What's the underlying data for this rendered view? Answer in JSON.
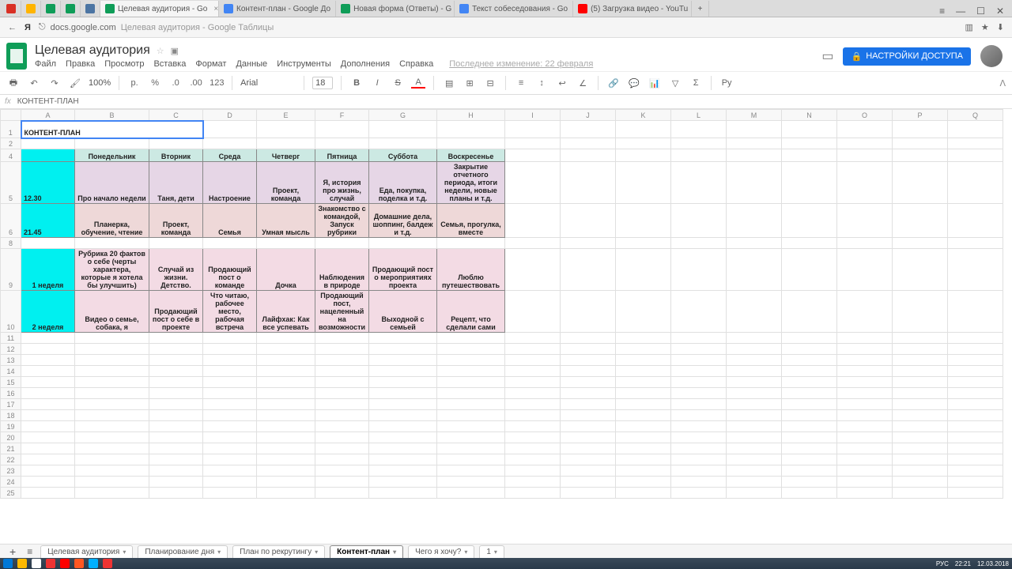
{
  "browser": {
    "tabs": [
      {
        "label": "",
        "favicon": "#d93025"
      },
      {
        "label": "",
        "favicon": "#ffb400"
      },
      {
        "label": "",
        "favicon": "#0f9d58"
      },
      {
        "label": "",
        "favicon": "#0f9d58"
      },
      {
        "label": "",
        "favicon": "#4c75a3"
      },
      {
        "label": "Целевая аудитория - Go",
        "favicon": "#0f9d58",
        "active": true,
        "close": "×"
      },
      {
        "label": "Контент-план - Google До",
        "favicon": "#4285f4"
      },
      {
        "label": "Новая форма (Ответы) - G",
        "favicon": "#0f9d58"
      },
      {
        "label": "Текст собеседования - Go",
        "favicon": "#4285f4"
      },
      {
        "label": "(5) Загрузка видео - YouTu",
        "favicon": "#ff0000"
      },
      {
        "label": "+",
        "favicon": "transparent"
      }
    ],
    "controls": {
      "menu": "≡",
      "min": "—",
      "max": "☐",
      "close": "✕"
    },
    "addr": {
      "back": "←",
      "ya": "Я",
      "lock": "⎋",
      "host": "docs.google.com",
      "title": "Целевая аудитория - Google Таблицы",
      "icons_right": [
        "▥",
        "★",
        "⬇"
      ]
    }
  },
  "doc": {
    "title": "Целевая аудитория",
    "star": "☆",
    "folder": "▣",
    "menus": [
      "Файл",
      "Правка",
      "Просмотр",
      "Вставка",
      "Формат",
      "Данные",
      "Инструменты",
      "Дополнения",
      "Справка"
    ],
    "last_edit": "Последнее изменение: 22 февраля",
    "comments_icon": "▭",
    "share": {
      "lock": "🔒",
      "label": "НАСТРОЙКИ ДОСТУПА"
    }
  },
  "toolbar": {
    "items_left": [
      "🖶",
      "↶",
      "↷",
      "🖌"
    ],
    "zoom": "100%",
    "currency": "р.",
    "percent": "%",
    "dec0": ".0",
    "dec00": ".00",
    "num": "123",
    "font": "Arial",
    "size": "18",
    "bold": "B",
    "italic": "I",
    "strike": "S",
    "underline": "A",
    "fill": "▤",
    "border": "⊞",
    "merge": "⊟",
    "align": "≡",
    "valign": "↕",
    "wrap": "↩",
    "rotate": "∠",
    "link": "🔗",
    "comment": "💬",
    "chart": "📊",
    "filter": "▽",
    "sigma": "Σ",
    "lang": "Ру",
    "collapse": "ᐱ"
  },
  "fx": {
    "label": "fx",
    "value": "КОНТЕНТ-ПЛАН"
  },
  "columns": [
    "A",
    "B",
    "C",
    "D",
    "E",
    "F",
    "G",
    "H",
    "I",
    "J",
    "K",
    "L",
    "M",
    "N",
    "O",
    "P",
    "Q"
  ],
  "cells": {
    "title": "КОНТЕНТ-ПЛАН",
    "days": [
      "Понедельник",
      "Вторник",
      "Среда",
      "Четверг",
      "Пятница",
      "Суббота",
      "Воскресенье"
    ],
    "times": [
      "12.30",
      "21.45"
    ],
    "weeks": [
      "1 неделя",
      "2 неделя"
    ],
    "row5": [
      "Про начало недели",
      "Таня, дети",
      "Настроение",
      "Проект, команда",
      "Я, история про жизнь, случай",
      "Еда, покупка, поделка и т.д.",
      "Закрытие отчетного периода, итоги недели, новые планы и т.д."
    ],
    "row6": [
      "Планерка, обучение, чтение",
      "Проект, команда",
      "Семья",
      "Умная мысль",
      "Знакомство с командой, Запуск рубрики",
      "Домашние дела, шоппинг, балдеж и т.д.",
      "Семья, прогулка, вместе"
    ],
    "row9": [
      "Рубрика 20 фактов о себе (черты характера, которые я хотела бы улучшить)",
      "Случай из жизни. Детство.",
      "Продающий пост о команде",
      "Дочка",
      "Наблюдения в природе",
      "Продающий пост о мероприятиях проекта",
      "Люблю путешествовать"
    ],
    "row10": [
      "Видео о семье, собака, я",
      "Продающий пост о себе в проекте",
      "Что читаю, рабочее место, рабочая встреча",
      "Лайфхак: Как все успевать",
      "Продающий пост, нацеленный на возможности",
      "Выходной с семьей",
      "Рецепт, что сделали сами"
    ]
  },
  "sheet_tabs": [
    {
      "label": "+"
    },
    {
      "label": "≡"
    },
    {
      "label": "Целевая аудитория"
    },
    {
      "label": "Планирование дня"
    },
    {
      "label": "План по рекрутингу"
    },
    {
      "label": "Контент-план",
      "active": true
    },
    {
      "label": "Чего я хочу?"
    },
    {
      "label": "1"
    }
  ],
  "taskbar": {
    "time": "22:21",
    "date": "12.03.2018",
    "lang": "РУС",
    "icons": [
      "#0078d7",
      "#ffb900",
      "#ffffff",
      "#fff",
      "#e33",
      "#f00",
      "#ff5722",
      "#00b0ff",
      "#e33"
    ]
  }
}
